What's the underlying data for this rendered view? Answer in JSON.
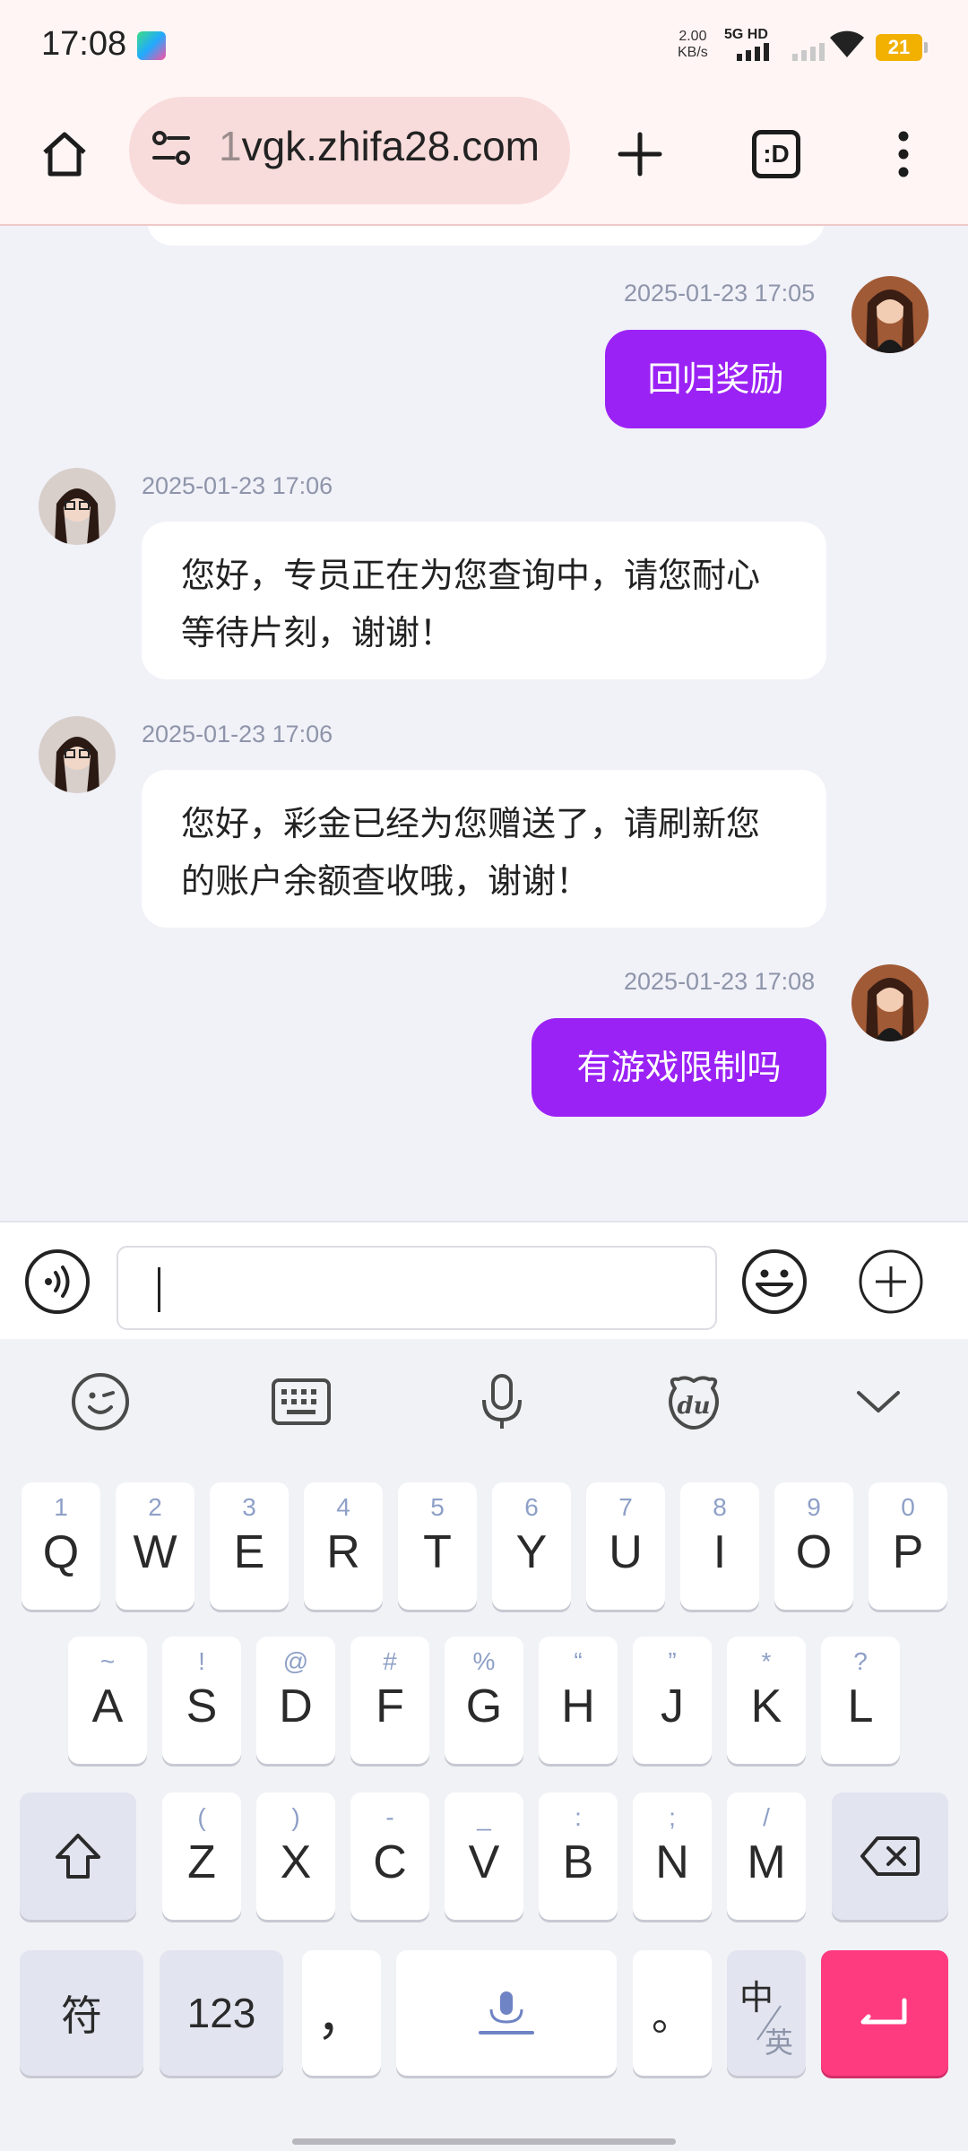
{
  "status": {
    "time": "17:08",
    "speed_value": "2.00",
    "speed_unit": "KB/s",
    "network": "5G HD",
    "battery": "21"
  },
  "browser": {
    "url_prefix": "1",
    "url": "vgk.zhifa28.com",
    "tab_count_label": ":D",
    "accent": "#f8dcdb"
  },
  "chat": {
    "messages": [
      {
        "side": "out",
        "time": "2025-01-23 17:05",
        "text": "回归奖励"
      },
      {
        "side": "in",
        "time": "2025-01-23 17:06",
        "text": "您好，专员正在为您查询中，请您耐心等待片刻，谢谢！"
      },
      {
        "side": "in",
        "time": "2025-01-23 17:06",
        "text": "您好，彩金已经为您赠送了，请刷新您的账户余额查收哦，谢谢！"
      },
      {
        "side": "out",
        "time": "2025-01-23 17:08",
        "text": "有游戏限制吗"
      }
    ],
    "out_bubble_color": "#9b22f5"
  },
  "input": {
    "value": ""
  },
  "keyboard": {
    "tools": [
      "emoji-face-icon",
      "keyboard-icon",
      "microphone-icon",
      "du-bear-icon",
      "chevron-down-icon"
    ],
    "row1": [
      {
        "hint": "1",
        "key": "Q"
      },
      {
        "hint": "2",
        "key": "W"
      },
      {
        "hint": "3",
        "key": "E"
      },
      {
        "hint": "4",
        "key": "R"
      },
      {
        "hint": "5",
        "key": "T"
      },
      {
        "hint": "6",
        "key": "Y"
      },
      {
        "hint": "7",
        "key": "U"
      },
      {
        "hint": "8",
        "key": "I"
      },
      {
        "hint": "9",
        "key": "O"
      },
      {
        "hint": "0",
        "key": "P"
      }
    ],
    "row2": [
      {
        "hint": "~",
        "key": "A"
      },
      {
        "hint": "!",
        "key": "S"
      },
      {
        "hint": "@",
        "key": "D"
      },
      {
        "hint": "#",
        "key": "F"
      },
      {
        "hint": "%",
        "key": "G"
      },
      {
        "hint": "“",
        "key": "H"
      },
      {
        "hint": "”",
        "key": "J"
      },
      {
        "hint": "*",
        "key": "K"
      },
      {
        "hint": "?",
        "key": "L"
      }
    ],
    "row3": [
      {
        "hint": "(",
        "key": "Z"
      },
      {
        "hint": ")",
        "key": "X"
      },
      {
        "hint": "-",
        "key": "C"
      },
      {
        "hint": "_",
        "key": "V"
      },
      {
        "hint": ":",
        "key": "B"
      },
      {
        "hint": ";",
        "key": "N"
      },
      {
        "hint": "/",
        "key": "M"
      }
    ],
    "symbols_label": "符",
    "numbers_label": "123",
    "comma_label": "，",
    "period_label": "。",
    "lang_top": "中",
    "lang_bottom": "英",
    "enter_color": "#ff3b7f"
  }
}
